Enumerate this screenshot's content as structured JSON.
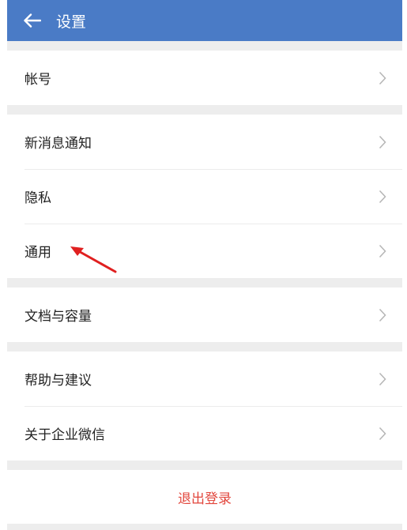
{
  "header": {
    "title": "设置",
    "back_icon": "arrow-left-icon"
  },
  "groups": [
    {
      "items": [
        {
          "label": "帐号"
        }
      ]
    },
    {
      "items": [
        {
          "label": "新消息通知"
        },
        {
          "label": "隐私"
        },
        {
          "label": "通用"
        }
      ]
    },
    {
      "items": [
        {
          "label": "文档与容量"
        }
      ]
    },
    {
      "items": [
        {
          "label": "帮助与建议"
        },
        {
          "label": "关于企业微信"
        }
      ]
    }
  ],
  "logout": {
    "label": "退出登录"
  },
  "colors": {
    "header_bg": "#4a7bc6",
    "logout_text": "#e2473d",
    "annotation_arrow": "#e02020"
  }
}
